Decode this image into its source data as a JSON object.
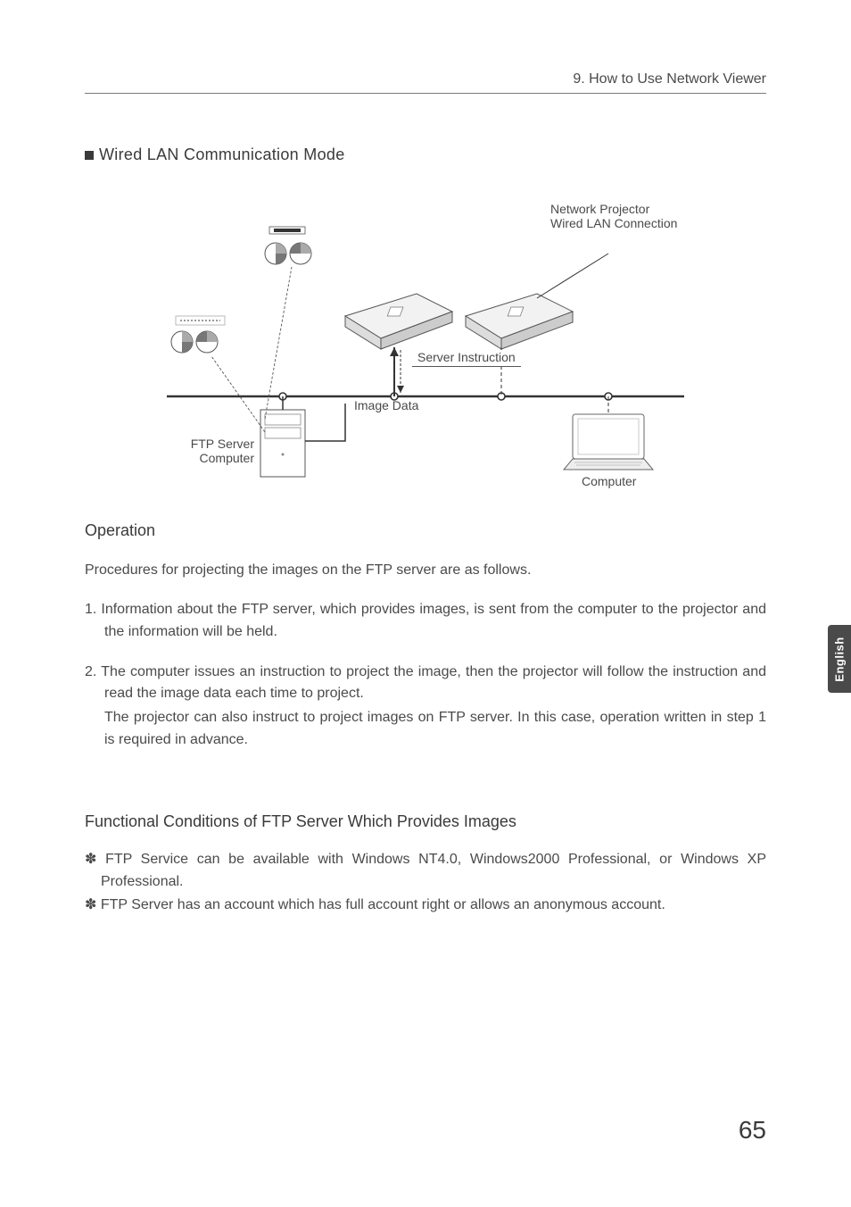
{
  "header": {
    "breadcrumb": "9. How to Use Network Viewer"
  },
  "section": {
    "title": "Wired LAN Communication Mode"
  },
  "diagram": {
    "labels": {
      "network_projector_l1": "Network Projector",
      "network_projector_l2": "Wired LAN Connection",
      "server_instruction": "Server Instruction",
      "image_data": "Image Data",
      "ftp_server_l1": "FTP Server",
      "ftp_server_l2": "Computer",
      "computer": "Computer"
    }
  },
  "operation": {
    "heading": "Operation",
    "intro": "Procedures for projecting the images on the FTP server are as follows.",
    "items": [
      {
        "num": "1.",
        "text": "Information about the FTP server, which provides images, is sent from the computer to the projector and the information will be held."
      },
      {
        "num": "2.",
        "text": "The computer issues an instruction to project the image, then the projector will follow the instruction and read the image data each time to project.",
        "cont": "The projector can also instruct to project images on FTP server.  In this case, operation written in step 1 is required in advance."
      }
    ]
  },
  "conditions": {
    "heading": "Functional Conditions of FTP Server Which Provides Images",
    "bullets": [
      "FTP Service can be available with Windows NT4.0, Windows2000 Professional, or Windows XP Professional.",
      "FTP Server has an account which has full account right or allows an anonymous account."
    ]
  },
  "side_tab": "English",
  "page_number": "65",
  "bullet_glyph": "✽"
}
